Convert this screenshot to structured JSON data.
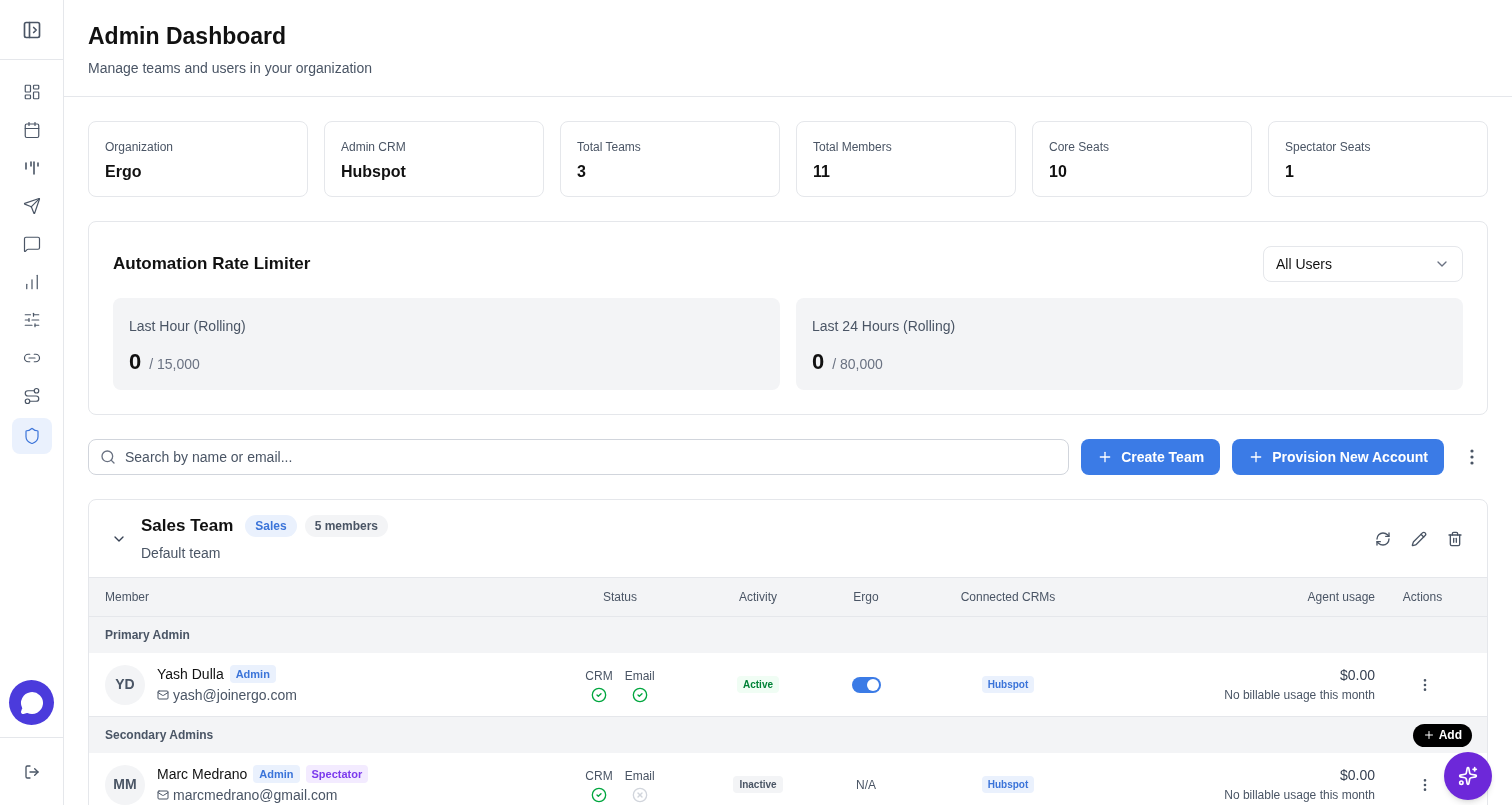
{
  "sidebar": {
    "items": [
      {
        "selected": false
      },
      {
        "selected": false
      },
      {
        "selected": false
      },
      {
        "selected": false
      },
      {
        "selected": false
      },
      {
        "selected": false
      },
      {
        "selected": false
      },
      {
        "selected": false
      },
      {
        "selected": false
      },
      {
        "selected": true
      }
    ]
  },
  "header": {
    "title": "Admin Dashboard",
    "subtitle": "Manage teams and users in your organization"
  },
  "stats": [
    {
      "label": "Organization",
      "value": "Ergo"
    },
    {
      "label": "Admin CRM",
      "value": "Hubspot"
    },
    {
      "label": "Total Teams",
      "value": "3"
    },
    {
      "label": "Total Members",
      "value": "11"
    },
    {
      "label": "Core Seats",
      "value": "10"
    },
    {
      "label": "Spectator Seats",
      "value": "1"
    }
  ],
  "rate_limiter": {
    "title": "Automation Rate Limiter",
    "filter": "All Users",
    "windows": [
      {
        "label": "Last Hour (Rolling)",
        "value": "0",
        "limit": "/ 15,000"
      },
      {
        "label": "Last 24 Hours (Rolling)",
        "value": "0",
        "limit": "/ 80,000"
      }
    ]
  },
  "toolbar": {
    "search_placeholder": "Search by name or email...",
    "buttons": [
      "Create Team",
      "Provision New Account"
    ]
  },
  "team": {
    "name": "Sales Team",
    "tag": "Sales",
    "members": "5 members",
    "description": "Default team",
    "expanded": true,
    "columns": [
      "Member",
      "Status",
      "Activity",
      "Ergo",
      "Connected CRMs",
      "Agent usage",
      "Actions"
    ],
    "sections": [
      {
        "title": "Primary Admin",
        "members": [
          {
            "initials": "YD",
            "name": "Yash Dulla",
            "badges": [
              {
                "label": "Admin",
                "kind": "admin"
              }
            ],
            "email": "yash@joinergo.com",
            "status": [
              {
                "label": "CRM",
                "ok": true
              },
              {
                "label": "Email",
                "ok": true
              }
            ],
            "activity": {
              "label": "Active",
              "active": true
            },
            "ergo": {
              "kind": "toggle",
              "on": true
            },
            "crms": [
              "Hubspot"
            ],
            "usage": "$0.00",
            "usage_note": "No billable usage this month"
          }
        ]
      },
      {
        "title": "Secondary Admins",
        "add": "Add",
        "members": [
          {
            "initials": "MM",
            "name": "Marc Medrano",
            "badges": [
              {
                "label": "Admin",
                "kind": "admin"
              },
              {
                "label": "Spectator",
                "kind": "spectator"
              }
            ],
            "email": "marcmedrano@gmail.com",
            "status": [
              {
                "label": "CRM",
                "ok": true
              },
              {
                "label": "Email",
                "ok": false
              }
            ],
            "activity": {
              "label": "Inactive",
              "active": false
            },
            "ergo": {
              "kind": "text",
              "text": "N/A"
            },
            "crms": [
              "Hubspot"
            ],
            "usage": "$0.00",
            "usage_note": "No billable usage this month"
          }
        ]
      }
    ]
  }
}
